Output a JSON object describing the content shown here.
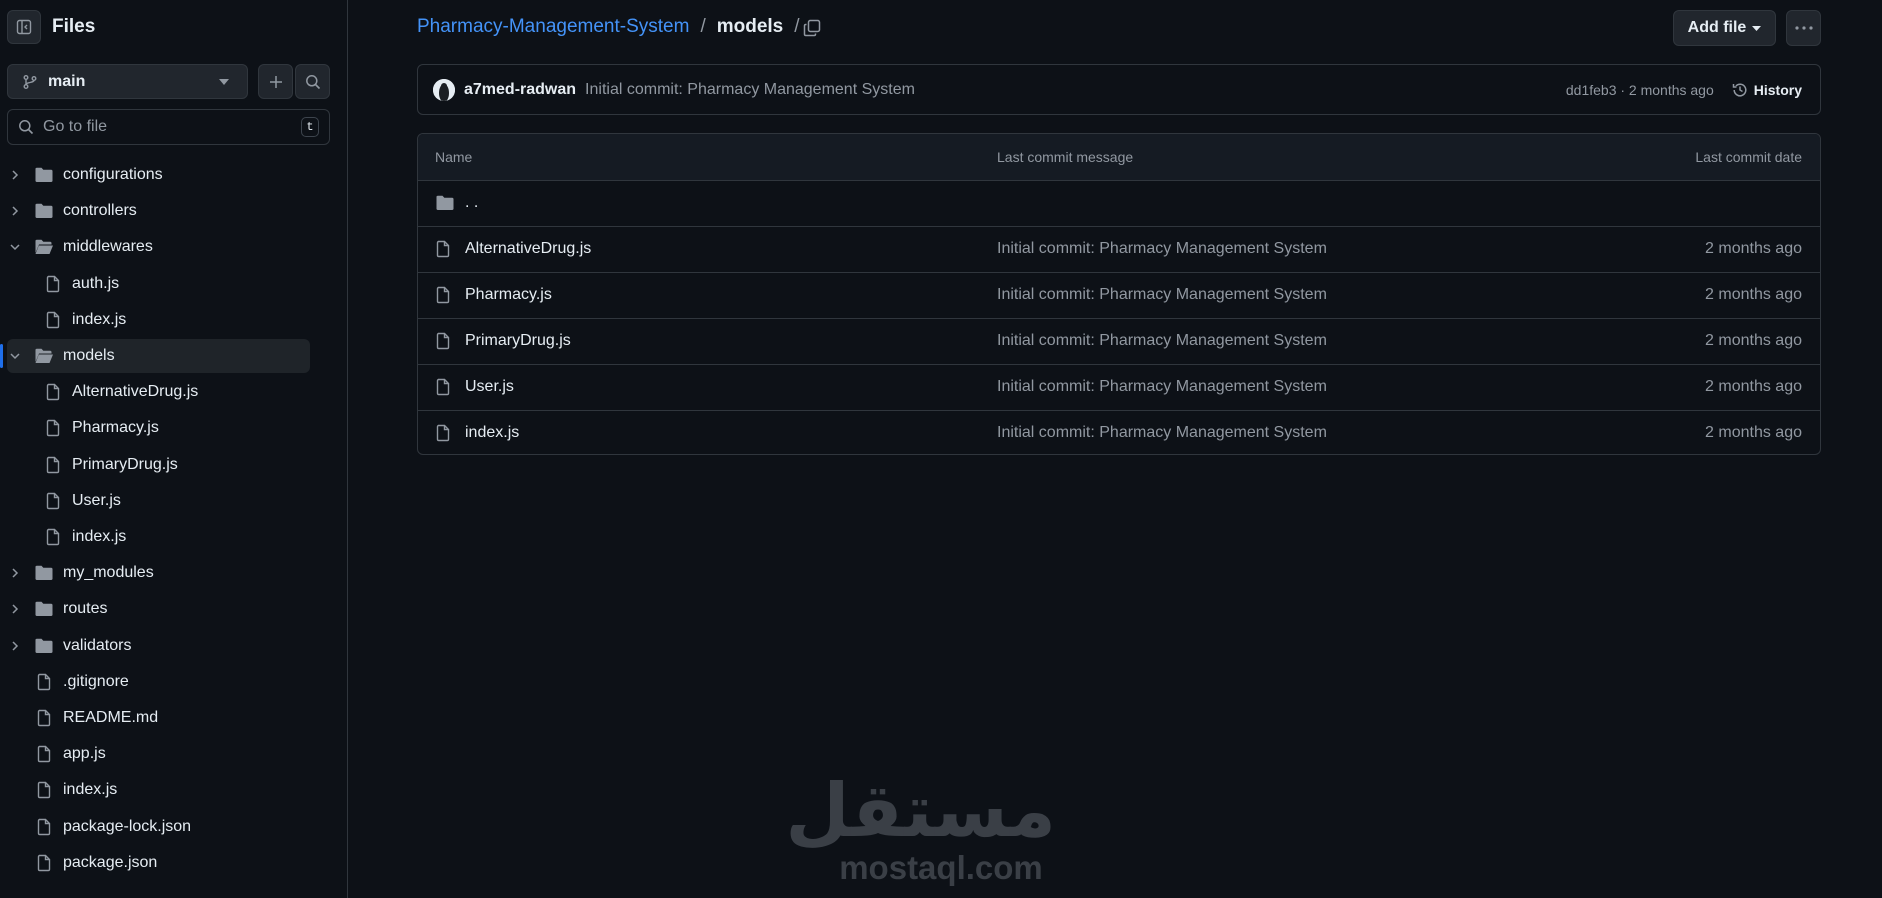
{
  "sidebar": {
    "title": "Files",
    "branch": "main",
    "goto_placeholder": "Go to file",
    "goto_shortcut": "t",
    "tree": [
      {
        "label": "configurations",
        "type": "folder",
        "depth": 0,
        "expanded": false
      },
      {
        "label": "controllers",
        "type": "folder",
        "depth": 0,
        "expanded": false
      },
      {
        "label": "middlewares",
        "type": "folder",
        "depth": 0,
        "expanded": true
      },
      {
        "label": "auth.js",
        "type": "file",
        "depth": 1
      },
      {
        "label": "index.js",
        "type": "file",
        "depth": 1
      },
      {
        "label": "models",
        "type": "folder",
        "depth": 0,
        "expanded": true,
        "selected": true
      },
      {
        "label": "AlternativeDrug.js",
        "type": "file",
        "depth": 1
      },
      {
        "label": "Pharmacy.js",
        "type": "file",
        "depth": 1
      },
      {
        "label": "PrimaryDrug.js",
        "type": "file",
        "depth": 1
      },
      {
        "label": "User.js",
        "type": "file",
        "depth": 1
      },
      {
        "label": "index.js",
        "type": "file",
        "depth": 1
      },
      {
        "label": "my_modules",
        "type": "folder",
        "depth": 0,
        "expanded": false
      },
      {
        "label": "routes",
        "type": "folder",
        "depth": 0,
        "expanded": false
      },
      {
        "label": "validators",
        "type": "folder",
        "depth": 0,
        "expanded": false
      },
      {
        "label": ".gitignore",
        "type": "file",
        "depth": 0
      },
      {
        "label": "README.md",
        "type": "file",
        "depth": 0
      },
      {
        "label": "app.js",
        "type": "file",
        "depth": 0
      },
      {
        "label": "index.js",
        "type": "file",
        "depth": 0
      },
      {
        "label": "package-lock.json",
        "type": "file",
        "depth": 0
      },
      {
        "label": "package.json",
        "type": "file",
        "depth": 0
      }
    ]
  },
  "breadcrumb": {
    "repo": "Pharmacy-Management-System",
    "separator": "/",
    "current": "models"
  },
  "toolbar": {
    "add_file_label": "Add file"
  },
  "commit": {
    "author": "a7med-radwan",
    "message": "Initial commit: Pharmacy Management System",
    "sha_time": "dd1feb3 · 2 months ago",
    "history_label": "History"
  },
  "table": {
    "headers": {
      "name": "Name",
      "message": "Last commit message",
      "date": "Last commit date"
    },
    "parent_label": ". .",
    "rows": [
      {
        "name": "AlternativeDrug.js",
        "message": "Initial commit: Pharmacy Management System",
        "date": "2 months ago"
      },
      {
        "name": "Pharmacy.js",
        "message": "Initial commit: Pharmacy Management System",
        "date": "2 months ago"
      },
      {
        "name": "PrimaryDrug.js",
        "message": "Initial commit: Pharmacy Management System",
        "date": "2 months ago"
      },
      {
        "name": "User.js",
        "message": "Initial commit: Pharmacy Management System",
        "date": "2 months ago"
      },
      {
        "name": "index.js",
        "message": "Initial commit: Pharmacy Management System",
        "date": "2 months ago"
      }
    ]
  },
  "watermark": {
    "arabic": "مستقل",
    "latin": "mostaql.com"
  },
  "colors": {
    "background": "#0d1117",
    "border": "#30363d",
    "link": "#4493f8",
    "muted": "#9198a1",
    "text": "#e6edf3",
    "selection_bar": "#1f6feb"
  }
}
